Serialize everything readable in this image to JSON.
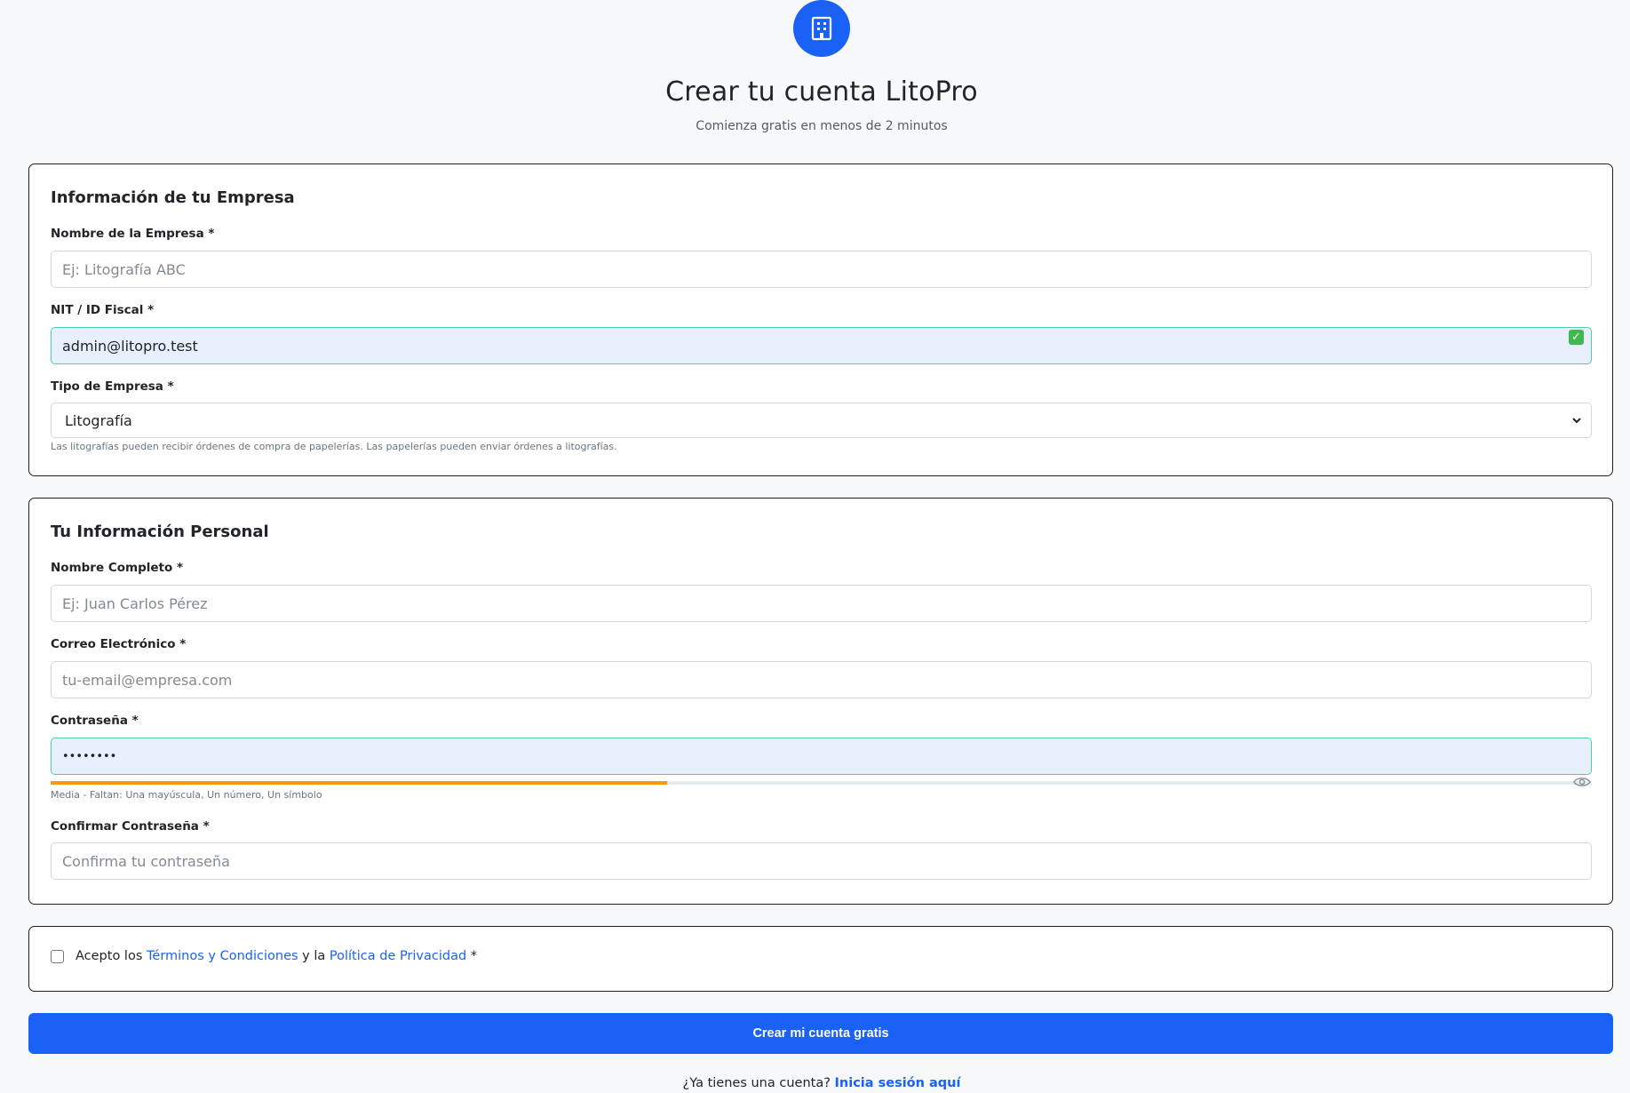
{
  "header": {
    "logo_icon": "building-icon",
    "title": "Crear tu cuenta LitoPro",
    "subtitle": "Comienza gratis en menos de 2 minutos"
  },
  "company_section": {
    "title": "Información de tu Empresa",
    "company_name": {
      "label": "Nombre de la Empresa *",
      "placeholder": "Ej: Litografía ABC",
      "value": ""
    },
    "tax_id": {
      "label": "NIT / ID Fiscal *",
      "value": "admin@litopro.test",
      "status_icon": "check-icon"
    },
    "company_type": {
      "label": "Tipo de Empresa *",
      "selected": "Litografía",
      "help": "Las litografías pueden recibir órdenes de compra de papelerías. Las papelerías pueden enviar órdenes a litografías."
    }
  },
  "personal_section": {
    "title": "Tu Información Personal",
    "full_name": {
      "label": "Nombre Completo *",
      "placeholder": "Ej: Juan Carlos Pérez"
    },
    "email": {
      "label": "Correo Electrónico *",
      "placeholder": "tu-email@empresa.com"
    },
    "password": {
      "label": "Contraseña *",
      "value": "••••••••",
      "strength_fraction": 0.4,
      "strength_color": "#f39c12",
      "strength_text": "Media - Faltan: Una mayúscula, Un número, Un símbolo"
    },
    "confirm_password": {
      "label": "Confirmar Contraseña *",
      "placeholder": "Confirma tu contraseña"
    }
  },
  "terms": {
    "prefix": "Acepto los",
    "terms_link": "Términos y Condiciones",
    "middle": "y la",
    "privacy_link": "Política de Privacidad",
    "suffix": "*"
  },
  "submit_label": "Crear mi cuenta gratis",
  "footer": {
    "prompt": "¿Ya tienes una cuenta?",
    "login_link": "Inicia sesión aquí"
  },
  "colors": {
    "primary": "#1a62f5",
    "valid_border": "#4fd1a5",
    "valid_bg": "#e8f0fe"
  }
}
